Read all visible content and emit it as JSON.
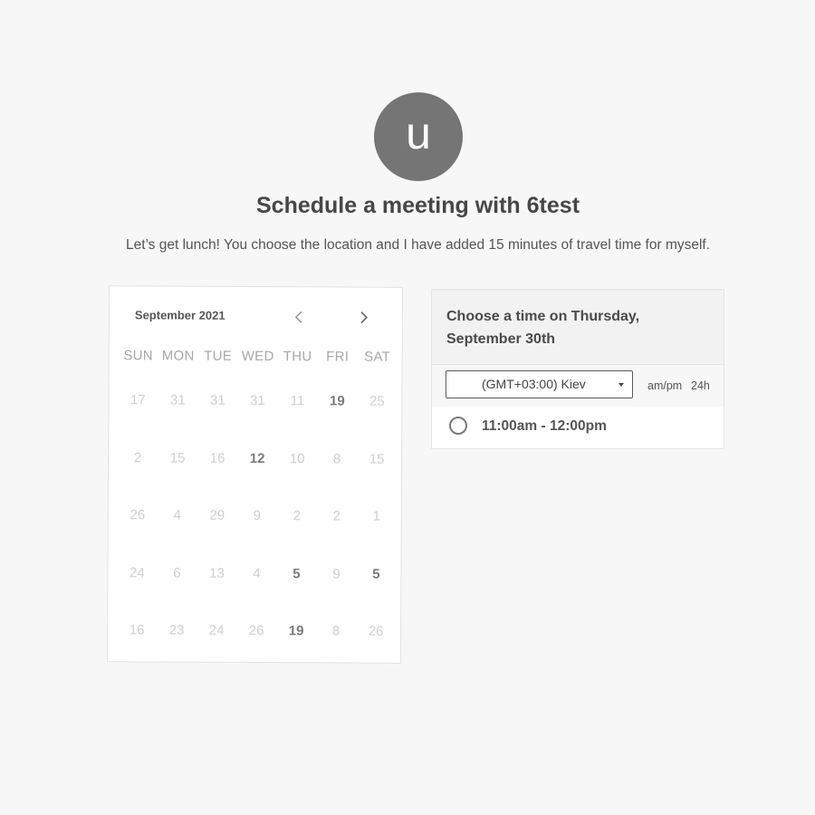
{
  "host": {
    "avatar_letter": "u"
  },
  "header": {
    "title": "Schedule a meeting with 6test",
    "description": "Let’s get lunch! You choose the location and I have added 15 minutes of travel time for myself."
  },
  "calendar": {
    "month_label": "September 2021",
    "prev_icon": "chevron-left-icon",
    "next_icon": "chevron-right-icon",
    "weekdays": [
      "SUN",
      "MON",
      "TUE",
      "WED",
      "THU",
      "FRI",
      "SAT"
    ],
    "weeks": [
      [
        {
          "d": "17",
          "b": false
        },
        {
          "d": "31",
          "b": false
        },
        {
          "d": "31",
          "b": false
        },
        {
          "d": "31",
          "b": false
        },
        {
          "d": "11",
          "b": false
        },
        {
          "d": "19",
          "b": true
        },
        {
          "d": "25",
          "b": false
        }
      ],
      [
        {
          "d": "2",
          "b": false
        },
        {
          "d": "15",
          "b": false
        },
        {
          "d": "16",
          "b": false
        },
        {
          "d": "12",
          "b": true
        },
        {
          "d": "10",
          "b": false
        },
        {
          "d": "8",
          "b": false
        },
        {
          "d": "15",
          "b": false
        }
      ],
      [
        {
          "d": "26",
          "b": false
        },
        {
          "d": "4",
          "b": false
        },
        {
          "d": "29",
          "b": false
        },
        {
          "d": "9",
          "b": false
        },
        {
          "d": "2",
          "b": false
        },
        {
          "d": "2",
          "b": false
        },
        {
          "d": "1",
          "b": false
        }
      ],
      [
        {
          "d": "24",
          "b": false
        },
        {
          "d": "6",
          "b": false
        },
        {
          "d": "13",
          "b": false
        },
        {
          "d": "4",
          "b": false
        },
        {
          "d": "5",
          "b": true
        },
        {
          "d": "9",
          "b": false
        },
        {
          "d": "5",
          "b": true
        }
      ],
      [
        {
          "d": "16",
          "b": false
        },
        {
          "d": "23",
          "b": false
        },
        {
          "d": "24",
          "b": false
        },
        {
          "d": "26",
          "b": false
        },
        {
          "d": "19",
          "b": true
        },
        {
          "d": "8",
          "b": false
        },
        {
          "d": "26",
          "b": false
        }
      ]
    ]
  },
  "time_panel": {
    "heading": "Choose a time on Thursday, September 30th",
    "timezone": {
      "selected": "(GMT+03:00) Kiev",
      "icon": "caret-down-icon"
    },
    "format_ampm": "am/pm",
    "format_24h": "24h",
    "slots": [
      {
        "label": "11:00am - 12:00pm"
      }
    ]
  },
  "colors": {
    "background": "#f7f7f7",
    "avatar": "#757575",
    "card": "#ffffff",
    "panel_header": "#f2f2f2"
  }
}
